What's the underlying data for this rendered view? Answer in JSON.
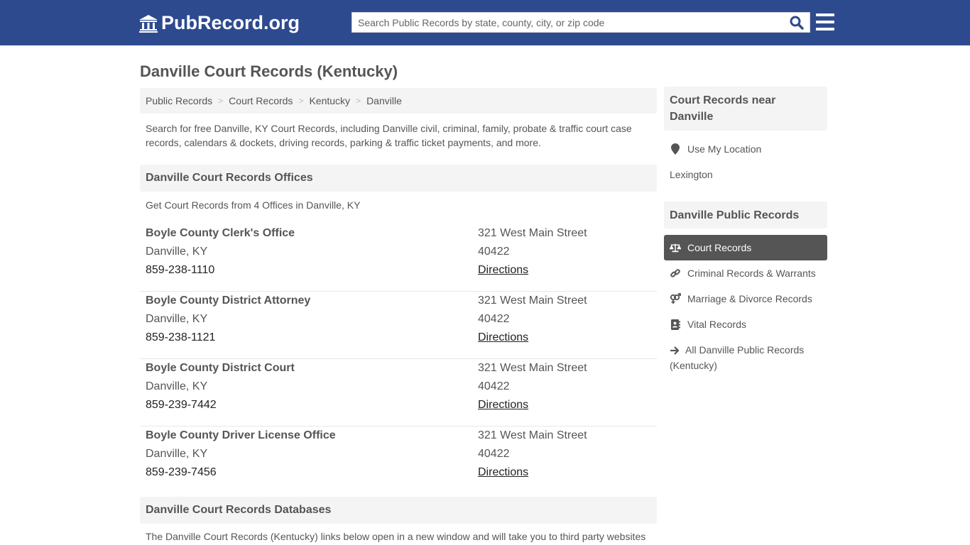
{
  "header": {
    "logo_text": "PubRecord.org",
    "search_placeholder": "Search Public Records by state, county, city, or zip code",
    "brand_color": "#2e4a8f"
  },
  "page": {
    "title": "Danville Court Records (Kentucky)",
    "breadcrumb": [
      "Public Records",
      "Court Records",
      "Kentucky",
      "Danville"
    ],
    "breadcrumb_separator": ">",
    "intro": "Search for free Danville, KY Court Records, including Danville civil, criminal, family, probate & traffic court case records, calendars & dockets, driving records, parking & traffic ticket payments, and more."
  },
  "offices_section": {
    "heading": "Danville Court Records Offices",
    "subheading": "Get Court Records from 4 Offices in Danville, KY",
    "directions_label": "Directions",
    "offices": [
      {
        "name": "Boyle County Clerk's Office",
        "city": "Danville, KY",
        "phone": "859-238-1110",
        "address": "321 West Main Street",
        "zip": "40422"
      },
      {
        "name": "Boyle County District Attorney",
        "city": "Danville, KY",
        "phone": "859-238-1121",
        "address": "321 West Main Street",
        "zip": "40422"
      },
      {
        "name": "Boyle County District Court",
        "city": "Danville, KY",
        "phone": "859-239-7442",
        "address": "321 West Main Street",
        "zip": "40422"
      },
      {
        "name": "Boyle County Driver License Office",
        "city": "Danville, KY",
        "phone": "859-239-7456",
        "address": "321 West Main Street",
        "zip": "40422"
      }
    ]
  },
  "databases_section": {
    "heading": "Danville Court Records Databases",
    "text": "The Danville Court Records (Kentucky) links below open in a new window and will take you to third party websites"
  },
  "sidebar": {
    "nearby_heading": "Court Records near Danville",
    "use_location_label": "Use My Location",
    "nearby_cities": [
      "Lexington"
    ],
    "public_records_heading": "Danville Public Records",
    "items": [
      {
        "label": "Court Records",
        "icon": "balance-scale-icon",
        "active": true
      },
      {
        "label": "Criminal Records & Warrants",
        "icon": "link-icon",
        "active": false
      },
      {
        "label": "Marriage & Divorce Records",
        "icon": "venus-mars-icon",
        "active": false
      },
      {
        "label": "Vital Records",
        "icon": "address-book-icon",
        "active": false
      }
    ],
    "all_records_label": "All Danville Public Records (Kentucky)"
  }
}
